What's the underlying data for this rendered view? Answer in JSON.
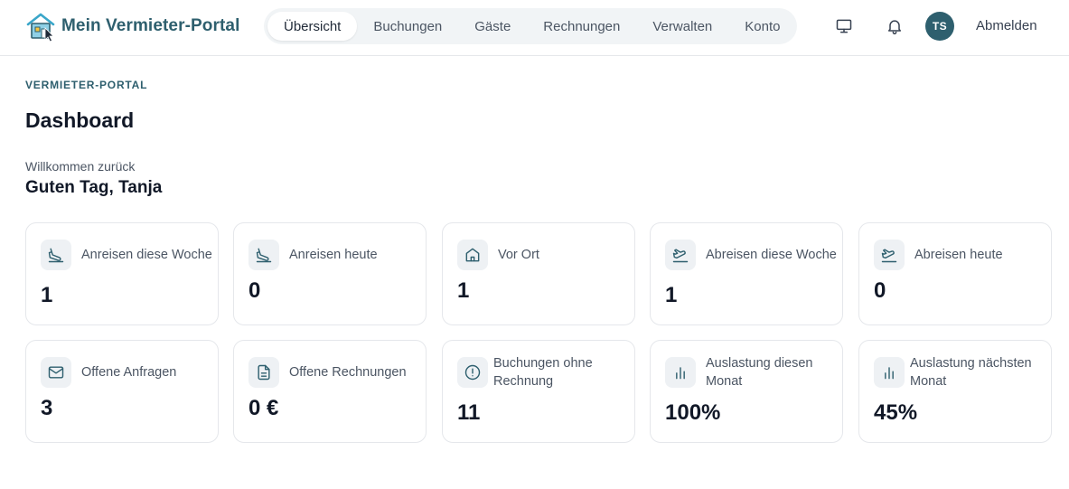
{
  "app": {
    "name": "Mein Vermieter-Portal",
    "logo_icon": "house-cursor-icon",
    "accent_color": "#2e5f6e"
  },
  "nav": {
    "tabs": [
      {
        "label": "Übersicht",
        "active": true
      },
      {
        "label": "Buchungen",
        "active": false
      },
      {
        "label": "Gäste",
        "active": false
      },
      {
        "label": "Rechnungen",
        "active": false
      },
      {
        "label": "Verwalten",
        "active": false
      },
      {
        "label": "Konto",
        "active": false
      }
    ]
  },
  "header": {
    "monitor_icon": "monitor-icon",
    "bell_icon": "bell-icon",
    "avatar_initials": "TS",
    "logout_label": "Abmelden"
  },
  "page": {
    "eyebrow": "VERMIETER-PORTAL",
    "title": "Dashboard",
    "welcome": "Willkommen zurück",
    "greeting": "Guten Tag, Tanja"
  },
  "cards": [
    {
      "label": "Anreisen diese Woche",
      "value": "1",
      "icon": "arrival-icon"
    },
    {
      "label": "Anreisen heute",
      "value": "0",
      "icon": "arrival-icon"
    },
    {
      "label": "Vor Ort",
      "value": "1",
      "icon": "home-icon"
    },
    {
      "label": "Abreisen diese Woche",
      "value": "1",
      "icon": "departure-icon"
    },
    {
      "label": "Abreisen heute",
      "value": "0",
      "icon": "departure-icon"
    },
    {
      "label": "Offene Anfragen",
      "value": "3",
      "icon": "mail-icon"
    },
    {
      "label": "Offene Rechnungen",
      "value": "0 €",
      "icon": "document-icon"
    },
    {
      "label": "Buchungen ohne Rechnung",
      "value": "11",
      "icon": "alert-circle-icon"
    },
    {
      "label": "Auslastung diesen Monat",
      "value": "100%",
      "icon": "bar-chart-icon"
    },
    {
      "label": "Auslastung nächsten Monat",
      "value": "45%",
      "icon": "bar-chart-icon"
    }
  ]
}
